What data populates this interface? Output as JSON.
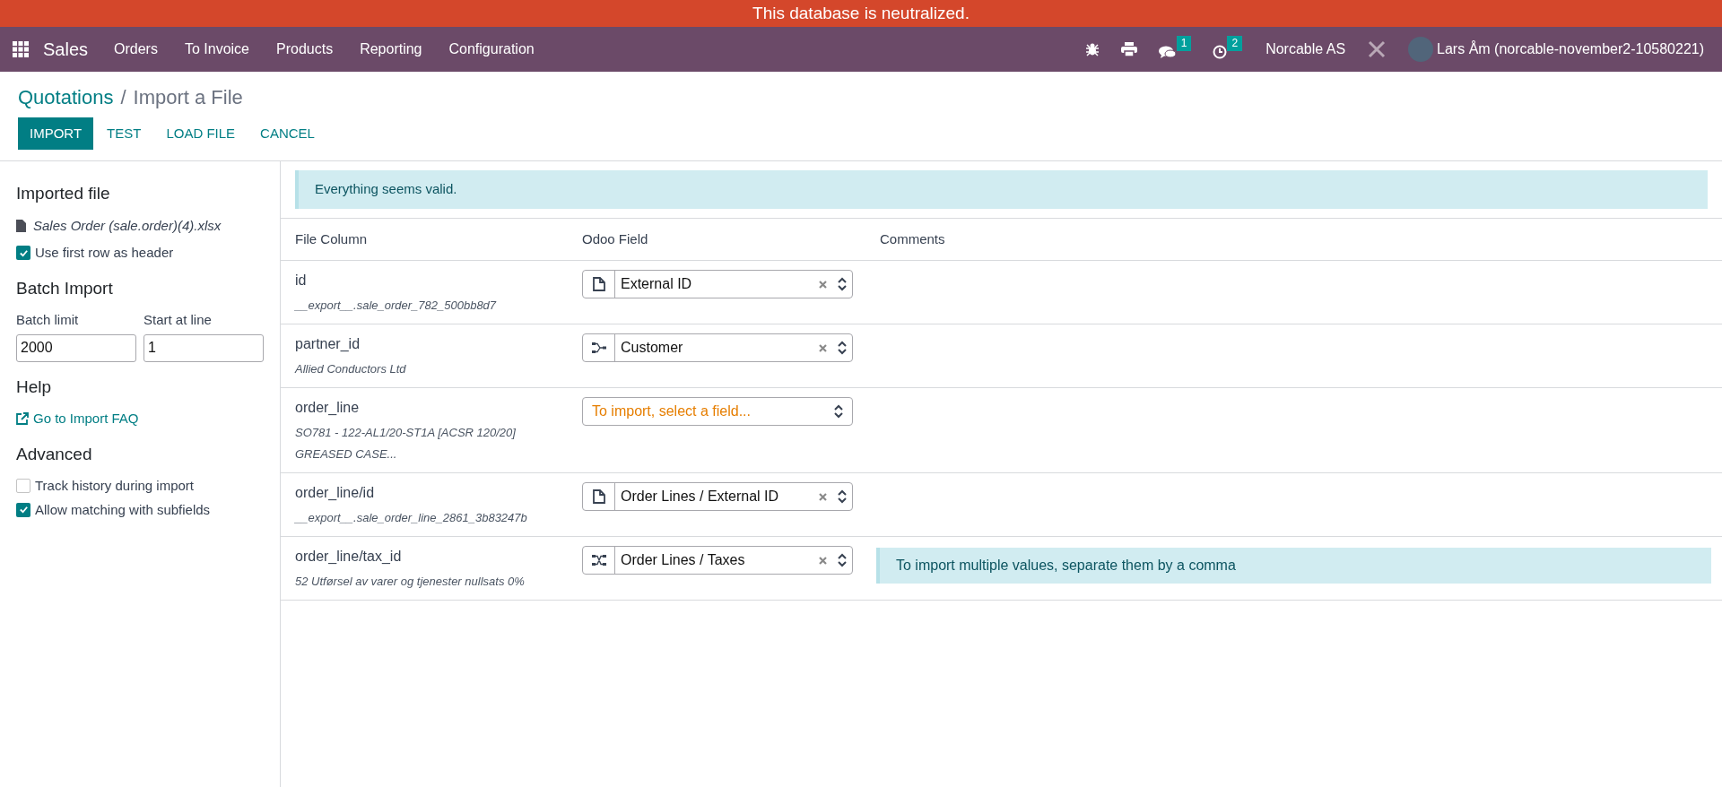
{
  "banner": "This database is neutralized.",
  "navbar": {
    "app": "Sales",
    "menu": [
      "Orders",
      "To Invoice",
      "Products",
      "Reporting",
      "Configuration"
    ],
    "messages_count": "1",
    "activities_count": "2",
    "company": "Norcable AS",
    "user": "Lars Åm (norcable-november2-10580221)"
  },
  "breadcrumb": {
    "parent": "Quotations",
    "separator": "/",
    "current": "Import a File"
  },
  "actions": [
    {
      "label": "IMPORT",
      "primary": true
    },
    {
      "label": "TEST",
      "primary": false
    },
    {
      "label": "LOAD FILE",
      "primary": false
    },
    {
      "label": "CANCEL",
      "primary": false
    }
  ],
  "sidebar": {
    "imported_file_heading": "Imported file",
    "file_name": "Sales Order (sale.order)(4).xlsx",
    "header_option": {
      "label": "Use first row as header",
      "checked": true
    },
    "batch_heading": "Batch Import",
    "batch_limit": {
      "label": "Batch limit",
      "value": "2000"
    },
    "start_line": {
      "label": "Start at line",
      "value": "1"
    },
    "help_heading": "Help",
    "help_link": "Go to Import FAQ",
    "advanced_heading": "Advanced",
    "advanced_options": [
      {
        "label": "Track history during import",
        "checked": false
      },
      {
        "label": "Allow matching with subfields",
        "checked": true
      }
    ]
  },
  "status_message": "Everything seems valid.",
  "table": {
    "columns": [
      "File Column",
      "Odoo Field",
      "Comments"
    ],
    "rows": [
      {
        "column": "id",
        "samples": [
          "__export__.sale_order_782_500bb8d7"
        ],
        "field": {
          "kind": "document",
          "value": "External ID"
        }
      },
      {
        "column": "partner_id",
        "samples": [
          "Allied Conductors Ltd"
        ],
        "field": {
          "kind": "relation",
          "value": "Customer"
        }
      },
      {
        "column": "order_line",
        "samples": [
          "SO781 - 122-AL1/20-ST1A [ACSR 120/20]",
          "GREASED CASE..."
        ],
        "field": {
          "kind": "empty",
          "placeholder": "To import, select a field..."
        }
      },
      {
        "column": "order_line/id",
        "samples": [
          "__export__.sale_order_line_2861_3b83247b"
        ],
        "field": {
          "kind": "document",
          "value": "Order Lines / External ID"
        }
      },
      {
        "column": "order_line/tax_id",
        "samples": [
          "52 Utførsel av varer og tjenester nullsats 0%"
        ],
        "field": {
          "kind": "multi",
          "value": "Order Lines / Taxes"
        },
        "comment": "To import multiple values, separate them by a comma"
      }
    ]
  }
}
